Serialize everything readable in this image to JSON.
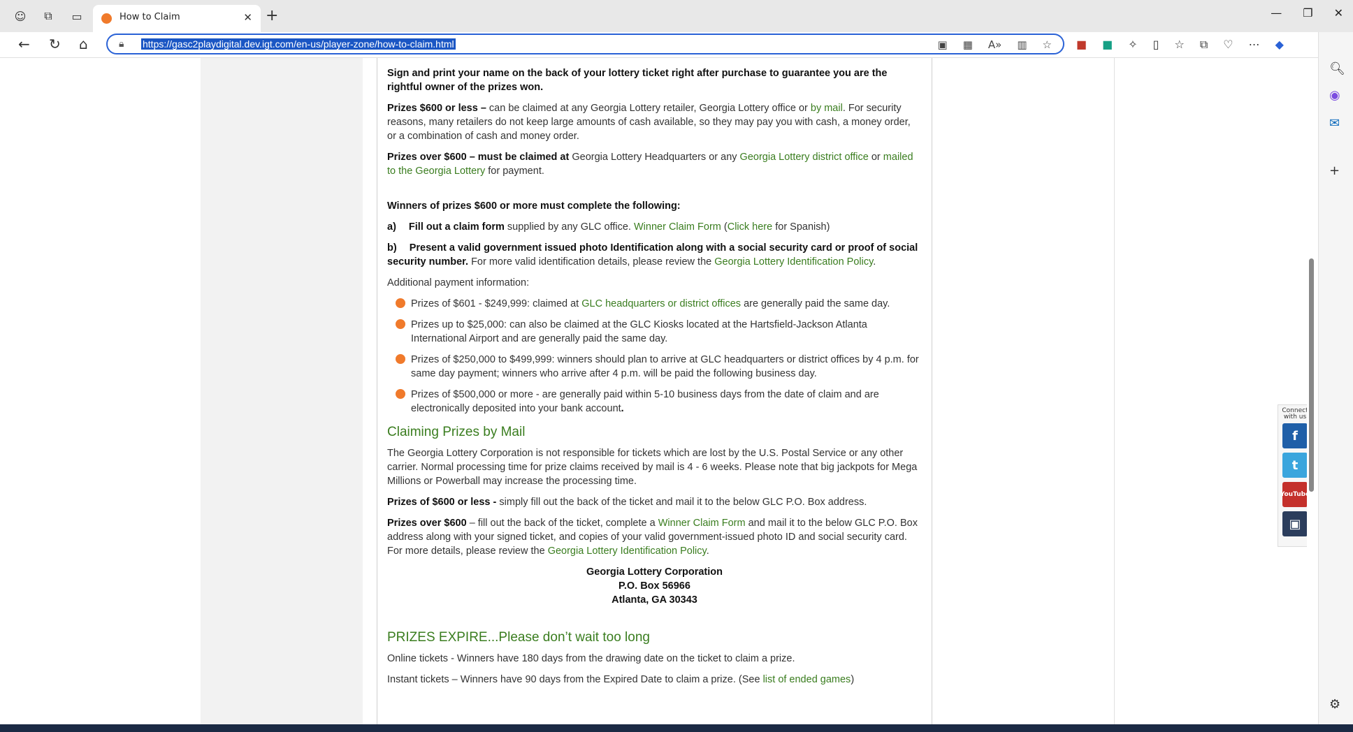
{
  "browser": {
    "tab_title": "How to Claim",
    "url": "https://gasc2playdigital.dev.igt.com/en-us/player-zone/how-to-claim.html"
  },
  "content": {
    "sign_print": "Sign and print your name on the back of your lottery ticket right after purchase to guarantee you are the rightful owner of the prizes won.",
    "p600_bold": "Prizes $600 or less –",
    "p600_text1": " can be claimed at any Georgia Lottery retailer, Georgia Lottery office or ",
    "p600_link": "by mail",
    "p600_text2": ". For security reasons, many retailers do not keep large amounts of cash available, so they may pay you with cash, a money order, or a combination of cash and money order.",
    "over_bold": "Prizes over $600 – must be claimed at",
    "over_text1": " Georgia Lottery Headquarters or any ",
    "over_link1": "Georgia Lottery district office",
    "over_text2": " or ",
    "over_link2": "mailed to the Georgia Lottery",
    "over_text3": " for payment.",
    "winners_heading": "Winners of prizes $600 or more must complete the following:",
    "a_label": "a)",
    "a_bold": "Fill out a claim form",
    "a_text": " supplied by any GLC office. ",
    "a_link1": "Winner Claim Form",
    "a_text2": "  (",
    "a_link2": "Click here",
    "a_text3": " for Spanish)",
    "b_label": "b)",
    "b_bold": "Present a valid government issued photo Identification along with a social security card or proof of social security number.",
    "b_text": "  For more valid identification details, please review the ",
    "b_link": "Georgia Lottery Identification Policy",
    "b_text2": ".",
    "additional": "Additional payment information:",
    "bullet1_text1": "Prizes of $601 - $249,999:  claimed at ",
    "bullet1_link": "GLC headquarters or district offices",
    "bullet1_text2": " are generally paid the same day.",
    "bullet2": "Prizes up to $25,000:  can also be claimed at the GLC Kiosks located at the Hartsfield-Jackson Atlanta International Airport and are generally paid the same day.",
    "bullet3": "Prizes of $250,000 to $499,999:  winners should plan to arrive at GLC headquarters or district offices by 4 p.m. for same day payment; winners who arrive after 4 p.m. will be paid the following business day.",
    "bullet4": "Prizes of $500,000 or more - are generally paid within 5-10 business days from the date of claim and are electronically deposited into your bank account",
    "bullet4_end": ".",
    "mail_heading": "Claiming Prizes by Mail",
    "mail_p1": "The Georgia Lottery Corporation is not responsible for tickets which are lost by the U.S. Postal Service or any other carrier. Normal processing time for prize claims received by mail is 4 - 6 weeks. Please note that big jackpots for Mega Millions or Powerball may increase the processing time.",
    "mail_p2_bold": "Prizes of $600 or less -",
    "mail_p2_text": " simply fill out the back of the ticket and mail it to the below GLC P.O. Box address.",
    "mail_p3_bold": "Prizes over $600",
    "mail_p3_text1": " – fill out the back of the ticket, complete a ",
    "mail_p3_link1": "Winner Claim Form",
    "mail_p3_text2": " and mail it to the below GLC P.O. Box address along with your signed ticket, and copies of your valid government-issued photo ID and social security card. For more details, please review the ",
    "mail_p3_link2": "Georgia Lottery Identification Policy",
    "mail_p3_text3": ".",
    "addr1": "Georgia Lottery Corporation",
    "addr2": "P.O. Box 56966",
    "addr3": "Atlanta, GA 30343",
    "expire_heading": "PRIZES EXPIRE...Please don’t wait too long",
    "expire_p1": "Online tickets - Winners have 180 days from the drawing date on the ticket to claim a prize.",
    "expire_p2_text": "Instant tickets – Winners have 90 days from the Expired Date to claim a prize. (See ",
    "expire_p2_link": "list of ended games",
    "expire_p2_end": ")"
  },
  "social": {
    "label": "Connect with us",
    "facebook": "f",
    "twitter": "t",
    "youtube": "YouTube",
    "instagram": "▣"
  }
}
